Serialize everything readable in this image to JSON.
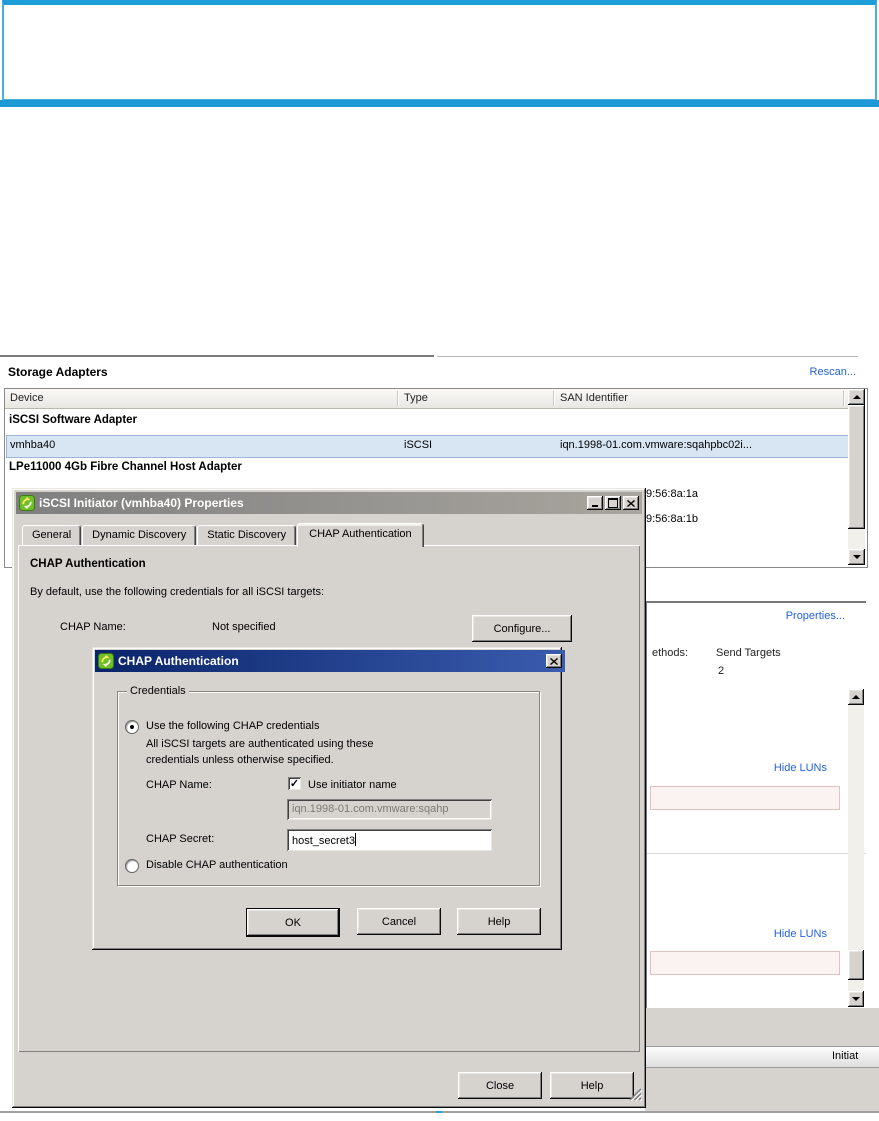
{
  "colors": {
    "banner_blue": "#1d9ad6",
    "link_blue": "#2463d8",
    "dialog_face": "#d6d3ce",
    "active_titlebar_blue": "#0a246a",
    "inactive_titlebar_gray": "#838383",
    "selected_row_bg": "#d8e6f4",
    "selected_row_border": "#9ab5da"
  },
  "storage_adapters": {
    "title": "Storage Adapters",
    "rescan_link": "Rescan...",
    "columns": [
      "Device",
      "Type",
      "SAN Identifier"
    ],
    "rows": [
      {
        "label": "iSCSI Software Adapter"
      },
      {
        "device": "vmhba40",
        "type": "iSCSI",
        "san_identifier": "iqn.1998-01.com.vmware:sqahpbc02i..."
      },
      {
        "label": "LPe11000 4Gb Fibre Channel Host Adapter"
      }
    ],
    "clipped_san_ids": [
      "9:56:8a:1a",
      "9:56:8a:1b"
    ]
  },
  "details_panel": {
    "properties_link": "Properties...",
    "methods_label_clipped": "ethods:",
    "methods_value": "Send Targets",
    "targets_count": "2",
    "hide_luns_links": [
      "Hide LUNs",
      "Hide LUNs"
    ],
    "initiator_label_clipped": "Initiat"
  },
  "properties_dialog": {
    "title": "iSCSI Initiator (vmhba40) Properties",
    "tabs": [
      "General",
      "Dynamic Discovery",
      "Static Discovery",
      "CHAP Authentication"
    ],
    "active_tab": "CHAP Authentication",
    "section_title": "CHAP Authentication",
    "description": "By default, use the following credentials for all iSCSI targets:",
    "chap_name_label": "CHAP Name:",
    "chap_name_value": "Not specified",
    "configure_button": "Configure...",
    "close_button": "Close",
    "help_button": "Help"
  },
  "chap_dialog": {
    "title": "CHAP Authentication",
    "group_label": "Credentials",
    "radio_use_label": "Use the following CHAP credentials",
    "radio_use_selected": true,
    "note_line1": "All iSCSI targets are authenticated using these",
    "note_line2": "credentials unless otherwise specified.",
    "chap_name_label": "CHAP Name:",
    "use_initiator_checkbox_label": "Use initiator name",
    "use_initiator_checked": true,
    "initiator_name_value_clipped": "iqn.1998-01.com.vmware:sqahp",
    "chap_secret_label": "CHAP Secret:",
    "chap_secret_value": "host_secret3",
    "radio_disable_label": "Disable CHAP authentication",
    "radio_disable_selected": false,
    "ok_button": "OK",
    "cancel_button": "Cancel",
    "help_button": "Help"
  }
}
